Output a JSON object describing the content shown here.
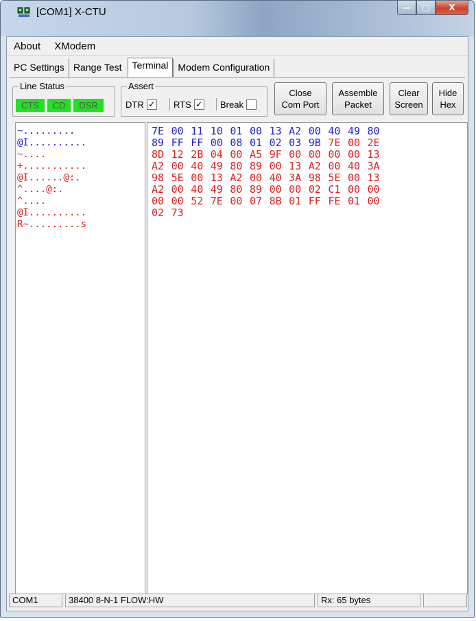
{
  "window": {
    "title": "[COM1] X-CTU",
    "minimize_label": "—",
    "maximize_label": "□",
    "close_label": "X"
  },
  "menu": [
    "About",
    "XModem"
  ],
  "tabs": [
    "PC Settings",
    "Range Test",
    "Terminal",
    "Modem Configuration"
  ],
  "active_tab": "Terminal",
  "line_status": {
    "label": "Line Status",
    "indicators": [
      "CTS",
      "CD",
      "DSR"
    ],
    "indicator_color": "#22e022"
  },
  "assert": {
    "label": "Assert",
    "items": [
      {
        "label": "DTR",
        "checked": true,
        "mark": "✓"
      },
      {
        "label": "RTS",
        "checked": true,
        "mark": "✓"
      },
      {
        "label": "Break",
        "checked": false,
        "mark": ""
      }
    ]
  },
  "buttons": [
    {
      "line1": "Close",
      "line2": "Com Port"
    },
    {
      "line1": "Assemble",
      "line2": "Packet"
    },
    {
      "line1": "Clear",
      "line2": "Screen"
    },
    {
      "line1": "Hide",
      "line2": "Hex"
    }
  ],
  "terminal": {
    "colors": {
      "sent": "#2222cc",
      "received": "#dd2222"
    },
    "ascii_lines": [
      {
        "text": "~.........",
        "dir": "sent"
      },
      {
        "text": "@I..........",
        "dir": "sent"
      },
      {
        "text": "~....",
        "dir": "received"
      },
      {
        "text": "+...........",
        "dir": "received"
      },
      {
        "text": "@I......@:.",
        "dir": "received"
      },
      {
        "text": "^....@:.",
        "dir": "received"
      },
      {
        "text": "^....",
        "dir": "received"
      },
      {
        "text": "@I..........",
        "dir": "received"
      },
      {
        "text": "R~.........s",
        "dir": "received"
      }
    ],
    "hex_lines": [
      {
        "bytes": [
          "7E",
          "00",
          "11",
          "10",
          "01",
          "00",
          "13",
          "A2",
          "00",
          "40",
          "49",
          "80"
        ],
        "dirs": [
          "sent",
          "sent",
          "sent",
          "sent",
          "sent",
          "sent",
          "sent",
          "sent",
          "sent",
          "sent",
          "sent",
          "sent"
        ]
      },
      {
        "bytes": [
          "89",
          "FF",
          "FF",
          "00",
          "08",
          "01",
          "02",
          "03",
          "9B",
          "7E",
          "00",
          "2E"
        ],
        "dirs": [
          "sent",
          "sent",
          "sent",
          "sent",
          "sent",
          "sent",
          "sent",
          "sent",
          "sent",
          "received",
          "received",
          "received"
        ]
      },
      {
        "bytes": [
          "8D",
          "12",
          "2B",
          "04",
          "00",
          "A5",
          "9F",
          "00",
          "00",
          "00",
          "00",
          "13"
        ],
        "dirs": [
          "received",
          "received",
          "received",
          "received",
          "received",
          "received",
          "received",
          "received",
          "received",
          "received",
          "received",
          "received"
        ]
      },
      {
        "bytes": [
          "A2",
          "00",
          "40",
          "49",
          "80",
          "89",
          "00",
          "13",
          "A2",
          "00",
          "40",
          "3A"
        ],
        "dirs": [
          "received",
          "received",
          "received",
          "received",
          "received",
          "received",
          "received",
          "received",
          "received",
          "received",
          "received",
          "received"
        ]
      },
      {
        "bytes": [
          "98",
          "5E",
          "00",
          "13",
          "A2",
          "00",
          "40",
          "3A",
          "98",
          "5E",
          "00",
          "13"
        ],
        "dirs": [
          "received",
          "received",
          "received",
          "received",
          "received",
          "received",
          "received",
          "received",
          "received",
          "received",
          "received",
          "received"
        ]
      },
      {
        "bytes": [
          "A2",
          "00",
          "40",
          "49",
          "80",
          "89",
          "00",
          "00",
          "02",
          "C1",
          "00",
          "00"
        ],
        "dirs": [
          "received",
          "received",
          "received",
          "received",
          "received",
          "received",
          "received",
          "received",
          "received",
          "received",
          "received",
          "received"
        ]
      },
      {
        "bytes": [
          "00",
          "00",
          "52",
          "7E",
          "00",
          "07",
          "8B",
          "01",
          "FF",
          "FE",
          "01",
          "00"
        ],
        "dirs": [
          "received",
          "received",
          "received",
          "received",
          "received",
          "received",
          "received",
          "received",
          "received",
          "received",
          "received",
          "received"
        ]
      },
      {
        "bytes": [
          "02",
          "73"
        ],
        "dirs": [
          "received",
          "received"
        ]
      }
    ]
  },
  "status": {
    "port": "COM1",
    "settings": "38400 8-N-1  FLOW:HW",
    "rx": "Rx: 65 bytes",
    "extra": ""
  }
}
